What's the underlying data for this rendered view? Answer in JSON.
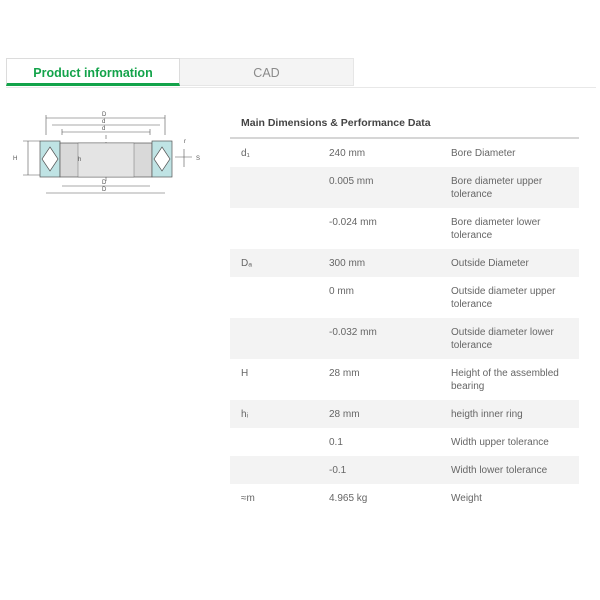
{
  "tabs": {
    "product_information": "Product information",
    "cad": "CAD"
  },
  "drawing": {
    "labels": {
      "dm": "D",
      "da": "d",
      "d1": "d",
      "D1": "D",
      "Da": "D",
      "H": "H",
      "h": "h",
      "s": "S",
      "r": "r"
    }
  },
  "table": {
    "title": "Main Dimensions & Performance Data",
    "rows": [
      {
        "symbol": "d₁",
        "value": "240 mm",
        "description": "Bore Diameter"
      },
      {
        "symbol": "",
        "value": "0.005 mm",
        "description": "Bore diameter upper tolerance"
      },
      {
        "symbol": "",
        "value": "-0.024 mm",
        "description": "Bore diameter lower tolerance"
      },
      {
        "symbol": "Dₐ",
        "value": "300 mm",
        "description": "Outside Diameter"
      },
      {
        "symbol": "",
        "value": "0 mm",
        "description": "Outside diameter upper tolerance"
      },
      {
        "symbol": "",
        "value": "-0.032 mm",
        "description": "Outside diameter lower tolerance"
      },
      {
        "symbol": "H",
        "value": "28 mm",
        "description": "Height of the assembled bearing"
      },
      {
        "symbol": "hᵢ",
        "value": "28 mm",
        "description": "heigth inner ring"
      },
      {
        "symbol": "",
        "value": "0.1",
        "description": "Width upper tolerance"
      },
      {
        "symbol": "",
        "value": "-0.1",
        "description": "Width lower tolerance"
      },
      {
        "symbol": "≈m",
        "value": "4.965 kg",
        "description": "Weight"
      }
    ]
  }
}
